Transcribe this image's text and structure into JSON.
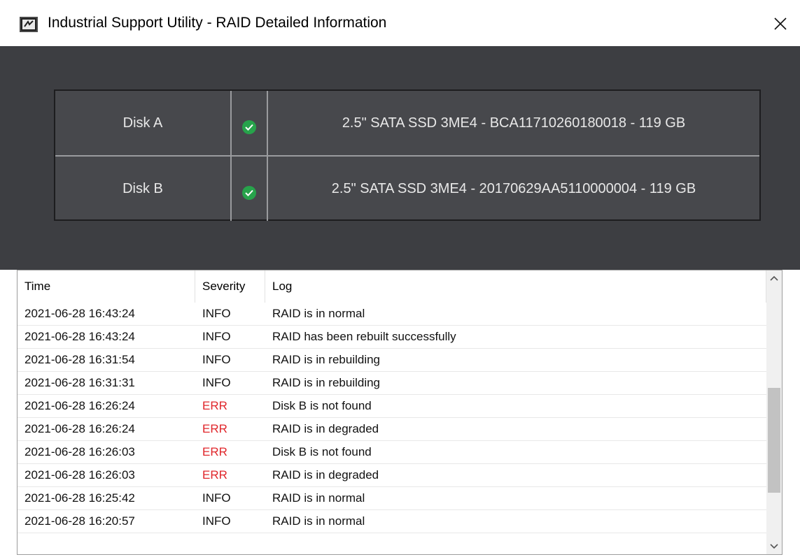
{
  "window": {
    "title": "Industrial Support Utility - RAID Detailed Information",
    "icon": "app-logo-icon",
    "close_icon": "close-icon"
  },
  "disks": [
    {
      "name": "Disk A",
      "status": "ok",
      "status_icon": "check-circle-icon",
      "info": "2.5\" SATA SSD 3ME4 - BCA11710260180018 - 119 GB"
    },
    {
      "name": "Disk B",
      "status": "ok",
      "status_icon": "check-circle-icon",
      "info": "2.5\" SATA SSD 3ME4 - 20170629AA5110000004 - 119 GB"
    }
  ],
  "log": {
    "columns": [
      "Time",
      "Severity",
      "Log"
    ],
    "rows": [
      {
        "time": "2021-06-28 16:43:24",
        "severity": "INFO",
        "message": "RAID is in normal"
      },
      {
        "time": "2021-06-28 16:43:24",
        "severity": "INFO",
        "message": "RAID has been rebuilt successfully"
      },
      {
        "time": "2021-06-28 16:31:54",
        "severity": "INFO",
        "message": "RAID is in rebuilding"
      },
      {
        "time": "2021-06-28 16:31:31",
        "severity": "INFO",
        "message": "RAID is in rebuilding"
      },
      {
        "time": "2021-06-28 16:26:24",
        "severity": "ERR",
        "message": "Disk B is not found"
      },
      {
        "time": "2021-06-28 16:26:24",
        "severity": "ERR",
        "message": "RAID is in degraded"
      },
      {
        "time": "2021-06-28 16:26:03",
        "severity": "ERR",
        "message": "Disk B is not found"
      },
      {
        "time": "2021-06-28 16:26:03",
        "severity": "ERR",
        "message": "RAID is in degraded"
      },
      {
        "time": "2021-06-28 16:25:42",
        "severity": "INFO",
        "message": "RAID is in normal"
      },
      {
        "time": "2021-06-28 16:20:57",
        "severity": "INFO",
        "message": "RAID is in normal"
      }
    ]
  },
  "colors": {
    "panel_bg": "#3d3e42",
    "ok_green": "#27a34b",
    "err_red": "#e0262b"
  }
}
